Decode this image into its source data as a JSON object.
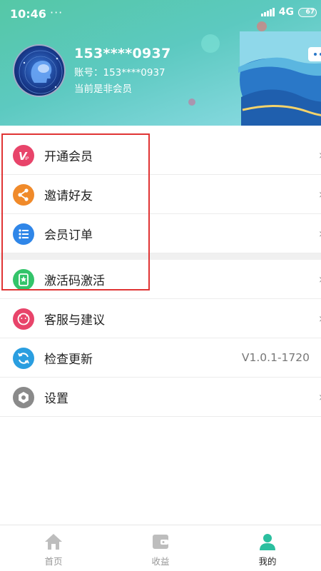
{
  "status_bar": {
    "time": "10:46",
    "dots": "···",
    "network": "4G",
    "battery": "67"
  },
  "profile": {
    "phone": "153****0937",
    "account": "账号：153****0937",
    "member_status": "当前是非会员"
  },
  "menu": [
    {
      "label": "开通会员",
      "icon": "vip-icon",
      "color": "#e8446a"
    },
    {
      "label": "邀请好友",
      "icon": "share-icon",
      "color": "#f08a2a"
    },
    {
      "label": "会员订单",
      "icon": "list-icon",
      "color": "#2f86e8"
    },
    {
      "label": "激活码激活",
      "icon": "bookmark-icon",
      "color": "#33c46a"
    },
    {
      "label": "客服与建议",
      "icon": "face-icon",
      "color": "#e8446a"
    },
    {
      "label": "检查更新",
      "icon": "refresh-icon",
      "color": "#2a9ee0",
      "value": "V1.0.1-1720"
    },
    {
      "label": "设置",
      "icon": "gear-icon",
      "color": "#8a8a8a"
    }
  ],
  "nav": [
    {
      "label": "首页",
      "icon": "home-icon"
    },
    {
      "label": "收益",
      "icon": "wallet-icon"
    },
    {
      "label": "我的",
      "icon": "user-icon"
    }
  ],
  "colors": {
    "accent": "#2bbf9f",
    "highlight": "#e03434"
  }
}
